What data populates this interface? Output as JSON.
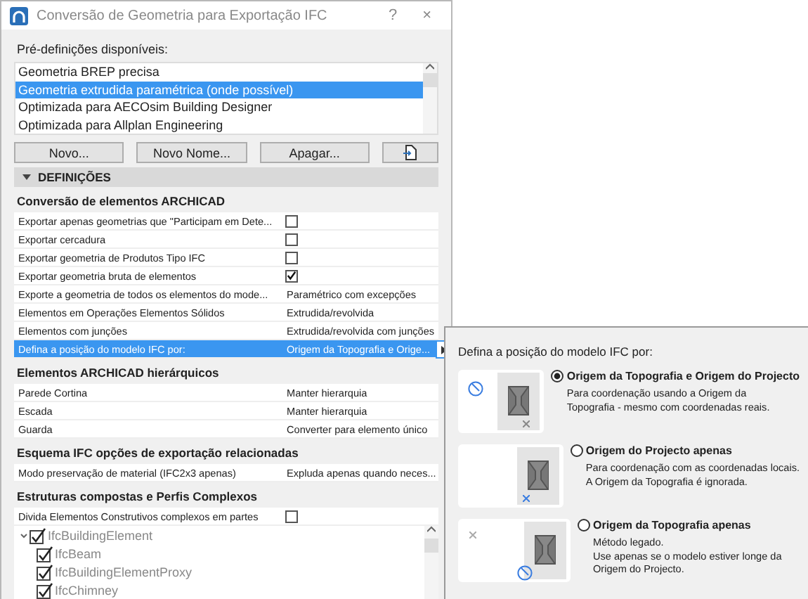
{
  "window": {
    "title": "Conversão de Geometria para Exportação IFC",
    "help": "?",
    "close": "×"
  },
  "presets": {
    "label": "Pré-definições disponíveis:",
    "items": [
      {
        "label": "Geometria BREP precisa",
        "selected": false
      },
      {
        "label": "Geometria extrudida paramétrica (onde possível)",
        "selected": true
      },
      {
        "label": "Optimizada para AECOsim Building Designer",
        "selected": false
      },
      {
        "label": "Optimizada para Allplan Engineering",
        "selected": false
      }
    ]
  },
  "preset_buttons": [
    {
      "label": "Novo..."
    },
    {
      "label": "Novo Nome..."
    },
    {
      "label": "Apagar..."
    }
  ],
  "settings": {
    "title": "DEFINIÇÕES",
    "expanded": true,
    "groups": [
      {
        "title": "Conversão de elementos ARCHICAD",
        "rows": [
          {
            "kind": "checkbox",
            "label": "Exportar apenas geometrias que \"Participam em Dete...",
            "checked": false,
            "selected": false
          },
          {
            "kind": "checkbox",
            "label": "Exportar cercadura",
            "checked": false,
            "selected": false
          },
          {
            "kind": "checkbox",
            "label": "Exportar geometria de Produtos Tipo IFC",
            "checked": false,
            "selected": false
          },
          {
            "kind": "checkbox",
            "label": "Exportar geometria bruta de elementos",
            "checked": true,
            "selected": false
          },
          {
            "kind": "value",
            "label": "Exporte a geometria de todos os elementos do mode...",
            "value": "Paramétrico com excepções",
            "selected": false
          },
          {
            "kind": "value",
            "label": "Elementos em Operações Elementos Sólidos",
            "value": "Extrudida/revolvida",
            "selected": false
          },
          {
            "kind": "value",
            "label": "Elementos com junções",
            "value": "Extrudida/revolvida com junções",
            "selected": false
          },
          {
            "kind": "value",
            "label": "Defina a posição do modelo IFC por:",
            "value": "Origem da Topografia e Orige...",
            "selected": true
          }
        ]
      },
      {
        "title": "Elementos ARCHICAD hierárquicos",
        "rows": [
          {
            "kind": "value",
            "label": "Parede Cortina",
            "value": "Manter hierarquia",
            "selected": false
          },
          {
            "kind": "value",
            "label": "Escada",
            "value": "Manter hierarquia",
            "selected": false
          },
          {
            "kind": "value",
            "label": "Guarda",
            "value": "Converter para elemento único",
            "selected": false
          }
        ]
      },
      {
        "title": "Esquema IFC opções de exportação relacionadas",
        "rows": [
          {
            "kind": "value",
            "label": "Modo preservação de material (IFC2x3 apenas)",
            "value": "Expluda apenas quando neces...",
            "selected": false
          }
        ]
      },
      {
        "title": "Estruturas compostas e Perfis Complexos",
        "rows": [
          {
            "kind": "checkbox",
            "label": "Divida Elementos Construtivos complexos em partes",
            "checked": false,
            "selected": false
          }
        ],
        "tree": [
          {
            "label": "IfcBuildingElement",
            "checked": true,
            "expanded": true,
            "children": [
              {
                "label": "IfcBeam",
                "checked": true
              },
              {
                "label": "IfcBuildingElementProxy",
                "checked": true
              },
              {
                "label": "IfcChimney",
                "checked": true
              }
            ]
          }
        ]
      }
    ]
  },
  "popup": {
    "title": "Defina a posição do modelo IFC por:",
    "options": [
      {
        "kind": "topo_and_project",
        "label": "Origem da Topografia e Origem do Projecto",
        "description": [
          "Para coordenação usando a Origem da",
          "Topografia - mesmo com coordenadas reais."
        ],
        "selected": true
      },
      {
        "kind": "project",
        "label": "Origem do Projecto apenas",
        "description": [
          "Para coordenação com as coordenadas locais.",
          "A Origem da Topografia é ignorada."
        ],
        "selected": false
      },
      {
        "kind": "topo",
        "label": "Origem da Topografia apenas",
        "description": [
          "Método legado.",
          "Use apenas se o modelo estiver longe da",
          "Origem do Projecto."
        ],
        "selected": false
      }
    ]
  }
}
